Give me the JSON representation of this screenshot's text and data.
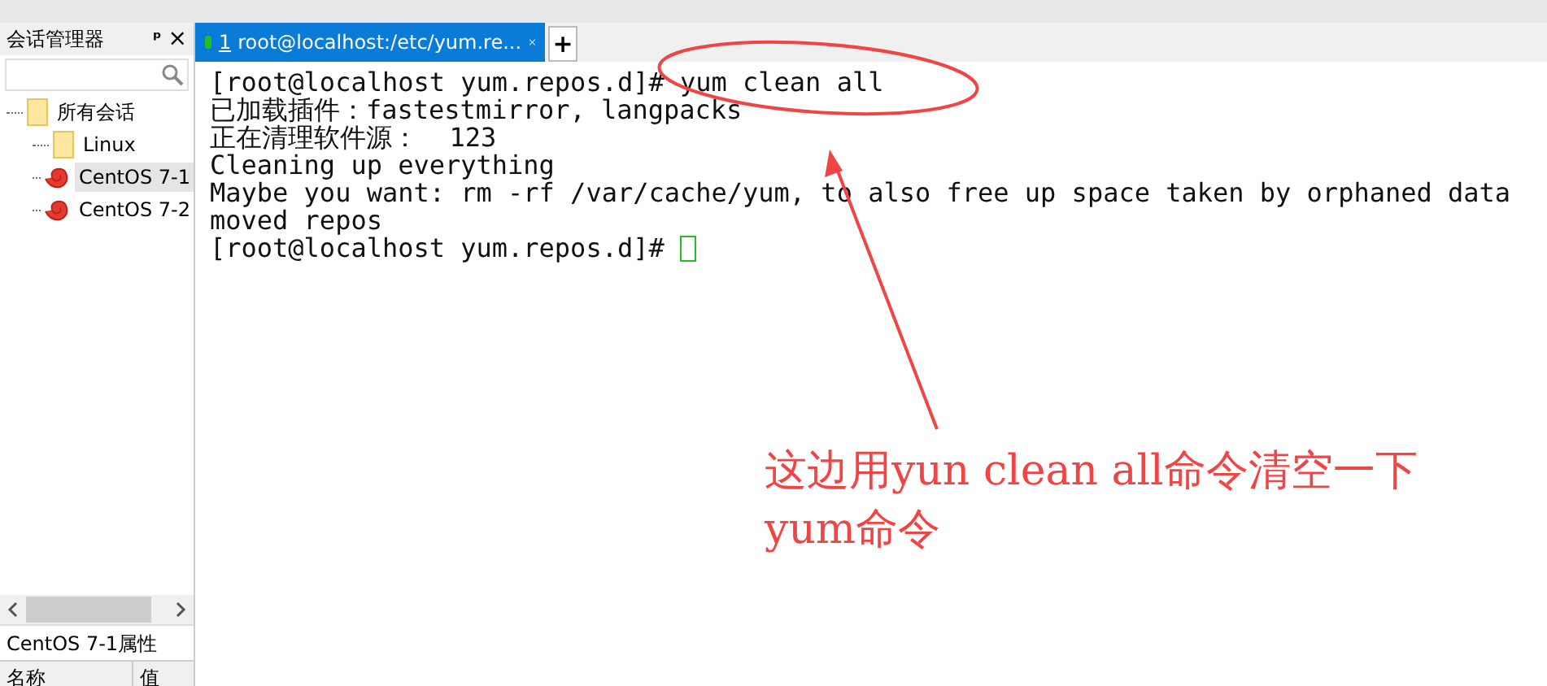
{
  "session_manager": {
    "title": "会话管理器",
    "pin": "ᵖ",
    "close": "×",
    "tree": [
      {
        "label": "所有会话",
        "kind": "folder",
        "selected": false,
        "children": [
          {
            "label": "Linux",
            "kind": "folder",
            "selected": false
          },
          {
            "label": "CentOS 7-1",
            "kind": "session",
            "selected": true
          },
          {
            "label": "CentOS 7-2",
            "kind": "session",
            "selected": false
          }
        ]
      }
    ],
    "properties": {
      "title": "CentOS 7-1属性",
      "columns": [
        "名称",
        "值"
      ]
    }
  },
  "tabs": [
    {
      "number": "1",
      "label": "root@localhost:/etc/yum.re...",
      "selected": true,
      "connected": true
    }
  ],
  "new_tab": "+",
  "terminal": {
    "lines": [
      "[root@localhost yum.repos.d]# yum clean all",
      "已加载插件：fastestmirror, langpacks",
      "正在清理软件源：  123",
      "Cleaning up everything",
      "Maybe you want: rm -rf /var/cache/yum, to also free up space taken by orphaned data",
      "moved repos",
      "[root@localhost yum.repos.d]# "
    ]
  },
  "annotation": {
    "text": "这边用yun clean all命令清空一下yum命令"
  }
}
